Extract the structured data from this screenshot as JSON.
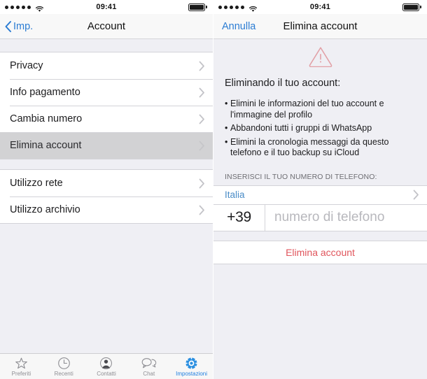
{
  "status_bar": {
    "time": "09:41",
    "signal_dots": 5,
    "wifi_icon": "wifi-icon",
    "battery_icon": "battery-full-icon"
  },
  "left_screen": {
    "nav": {
      "back_icon": "chevron-left-icon",
      "back_label": "Imp.",
      "title": "Account"
    },
    "groups": [
      {
        "rows": [
          {
            "label": "Privacy",
            "selected": false,
            "chevron": "chevron-right-icon"
          },
          {
            "label": "Info pagamento",
            "selected": false,
            "chevron": "chevron-right-icon"
          },
          {
            "label": "Cambia numero",
            "selected": false,
            "chevron": "chevron-right-icon"
          },
          {
            "label": "Elimina account",
            "selected": true,
            "chevron": "chevron-right-icon"
          }
        ]
      },
      {
        "rows": [
          {
            "label": "Utilizzo rete",
            "selected": false,
            "chevron": "chevron-right-icon"
          },
          {
            "label": "Utilizzo archivio",
            "selected": false,
            "chevron": "chevron-right-icon"
          }
        ]
      }
    ],
    "tabbar": {
      "items": [
        {
          "label": "Preferiti",
          "icon": "star-icon",
          "active": false
        },
        {
          "label": "Recenti",
          "icon": "clock-icon",
          "active": false
        },
        {
          "label": "Contatti",
          "icon": "person-icon",
          "active": false
        },
        {
          "label": "Chat",
          "icon": "chat-bubbles-icon",
          "active": false
        },
        {
          "label": "Impostazioni",
          "icon": "gear-icon",
          "active": true
        }
      ]
    }
  },
  "right_screen": {
    "nav": {
      "cancel_label": "Annulla",
      "title": "Elimina account"
    },
    "warning_icon": "warning-triangle-icon",
    "heading": "Eliminando il tuo account:",
    "bullets": [
      "Elimini le informazioni del tuo account e l'immagine del profilo",
      "Abbandoni tutti i gruppi di WhatsApp",
      "Elimini la cronologia messaggi da questo telefono e il tuo backup su iCloud"
    ],
    "section_header": "INSERISCI IL TUO NUMERO DI TELEFONO:",
    "country": {
      "name": "Italia",
      "chevron": "chevron-right-icon"
    },
    "phone": {
      "prefix": "+39",
      "value": "",
      "placeholder": "numero di telefono"
    },
    "delete_button_label": "Elimina account"
  },
  "colors": {
    "ios_blue": "#2b7cd3",
    "destructive_red": "#e0555c",
    "warning_pink": "#e2a0a6",
    "background": "#EFEFF4",
    "selected_row": "#d2d2d4",
    "tab_active": "#1f7fe0"
  }
}
